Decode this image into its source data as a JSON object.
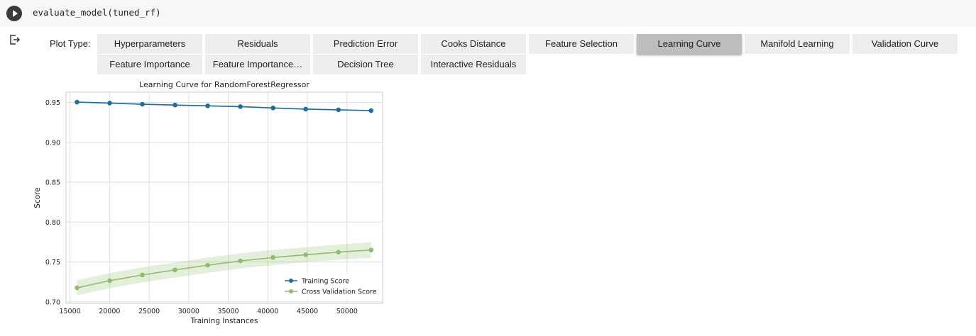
{
  "cell": {
    "code": "evaluate_model(tuned_rf)"
  },
  "widget": {
    "label": "Plot Type:",
    "buttons": [
      "Hyperparameters",
      "Residuals",
      "Prediction Error",
      "Cooks Distance",
      "Feature Selection",
      "Learning Curve",
      "Manifold Learning",
      "Validation Curve",
      "Feature Importance",
      "Feature Importance…",
      "Decision Tree",
      "Interactive Residuals"
    ],
    "selected": "Learning Curve"
  },
  "chart_data": {
    "type": "line",
    "title": "Learning Curve for RandomForestRegressor",
    "xlabel": "Training Instances",
    "ylabel": "Score",
    "xlim": [
      14500,
      54500
    ],
    "ylim": [
      0.698,
      0.963
    ],
    "xticks": [
      "15000",
      "20000",
      "25000",
      "30000",
      "35000",
      "40000",
      "45000",
      "50000"
    ],
    "yticks": [
      "0.70",
      "0.75",
      "0.80",
      "0.85",
      "0.90",
      "0.95"
    ],
    "grid": true,
    "legend_position": "bottom-right",
    "x": [
      15885,
      20014,
      24143,
      28272,
      32401,
      36530,
      40659,
      44788,
      48917,
      53046
    ],
    "series": [
      {
        "name": "Training Score",
        "color": "#1f6e98",
        "values": [
          0.9505,
          0.9493,
          0.9478,
          0.9468,
          0.9458,
          0.9448,
          0.9432,
          0.9417,
          0.9408,
          0.9398
        ],
        "band": [
          0.0008,
          0.0008,
          0.0008,
          0.0008,
          0.0008,
          0.0008,
          0.0008,
          0.0008,
          0.0008,
          0.0008
        ]
      },
      {
        "name": "Cross Validation Score",
        "color": "#8fbc6e",
        "values": [
          0.7175,
          0.7265,
          0.7337,
          0.74,
          0.7459,
          0.7513,
          0.7556,
          0.759,
          0.7623,
          0.765
        ],
        "band": [
          0.0095,
          0.0095,
          0.0095,
          0.0095,
          0.0095,
          0.0095,
          0.0095,
          0.0095,
          0.0095,
          0.01
        ]
      }
    ]
  }
}
